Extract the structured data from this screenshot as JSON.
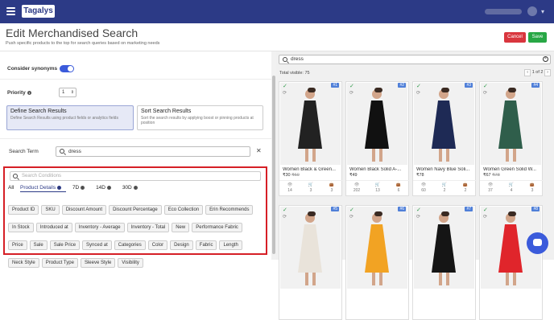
{
  "brand": {
    "logo_text": "Tagalys"
  },
  "header": {
    "title": "Edit Merchandised Search",
    "subtitle": "Push specific products to the top for search queries based on marketing needs",
    "cancel_label": "Cancel",
    "save_label": "Save"
  },
  "form": {
    "synonyms_label": "Consider synonyms",
    "synonyms_on": true,
    "priority_label": "Priority",
    "priority_value": "1",
    "define_title": "Define Search Results",
    "define_desc": "Define Search Results using product fields or analytics fields",
    "sort_title": "Sort Search Results",
    "sort_desc": "Sort the search results by applying boost or pinning products at position",
    "search_term_label": "Search Term",
    "search_term_value": "dress"
  },
  "conditions": {
    "search_placeholder": "Search Conditions",
    "tabs": [
      {
        "label": "All"
      },
      {
        "label": "Product Details"
      },
      {
        "label": "7D"
      },
      {
        "label": "14D"
      },
      {
        "label": "30D"
      }
    ],
    "chips": [
      "Product ID",
      "SKU",
      "Discount Amount",
      "Discount Percentage",
      "Eco Collection",
      "Erin Recommends",
      "In Stock",
      "Introduced at",
      "Inventory - Average",
      "Inventory - Total",
      "New",
      "Performance Fabric",
      "Price",
      "Sale",
      "Sale Price",
      "Synced at",
      "Categories",
      "Color",
      "Design",
      "Fabric",
      "Length",
      "Neck Style",
      "Product Type",
      "Sleeve Style",
      "Visibility"
    ]
  },
  "results": {
    "search_value": "dress",
    "total_visible": "Total visible: 75",
    "page_text": "1 of 2",
    "products": [
      {
        "num": "#1",
        "name": "Women Black & Green...",
        "price": "₹30",
        "mrp": "₹60",
        "views": "14",
        "cart": "3",
        "buy": "3",
        "color": "#222",
        "accent": "#c9a24a"
      },
      {
        "num": "#2",
        "name": "Women Black Solid A-...",
        "price": "₹49",
        "mrp": "",
        "views": "202",
        "cart": "13",
        "buy": "6",
        "color": "#111",
        "accent": "#111"
      },
      {
        "num": "#3",
        "name": "Women Navy Blue Soli...",
        "price": "₹78",
        "mrp": "",
        "views": "60",
        "cart": "2",
        "buy": "2",
        "color": "#1e2a55",
        "accent": "#1e2a55"
      },
      {
        "num": "#4",
        "name": "Women Green Solid W...",
        "price": "₹67",
        "mrp": "₹78",
        "views": "37",
        "cart": "4",
        "buy": "3",
        "color": "#2f5e4b",
        "accent": "#2f5e4b"
      },
      {
        "num": "#5",
        "name": "",
        "price": "",
        "mrp": "",
        "views": "",
        "cart": "",
        "buy": "",
        "color": "#e9e3da",
        "accent": "#e9e3da"
      },
      {
        "num": "#6",
        "name": "",
        "price": "",
        "mrp": "",
        "views": "",
        "cart": "",
        "buy": "",
        "color": "#f2a323",
        "accent": "#f2a323"
      },
      {
        "num": "#7",
        "name": "",
        "price": "",
        "mrp": "",
        "views": "",
        "cart": "",
        "buy": "",
        "color": "#151515",
        "accent": "#151515"
      },
      {
        "num": "#8",
        "name": "",
        "price": "",
        "mrp": "",
        "views": "",
        "cart": "",
        "buy": "",
        "color": "#e0252b",
        "accent": "#e0252b"
      }
    ]
  },
  "colors": {
    "nav": "#2c3a86",
    "cancel": "#d9363e",
    "save": "#28a745",
    "highlight": "#d61f26"
  }
}
